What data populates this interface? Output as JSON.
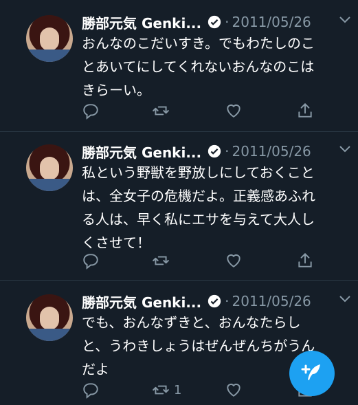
{
  "tweets": [
    {
      "name": "勝部元気 Genki...",
      "date": "2011/05/26",
      "lines": [
        "おんなのこだいすき。でもわたしのこ",
        "とあいてにしてくれないおんなのこは",
        "きらーい。"
      ],
      "retweet_count": ""
    },
    {
      "name": "勝部元気 Genki...",
      "date": "2011/05/26",
      "lines": [
        "私という野獣を野放しにしておくこと",
        "は、全女子の危機だよ。正義感あふれ",
        "る人は、早く私にエサを与えて大人し",
        "くさせて！"
      ],
      "retweet_count": ""
    },
    {
      "name": "勝部元気 Genki...",
      "date": "2011/05/26",
      "lines": [
        "でも、おんなずきと、おんなたらし",
        "と、うわきしょうはぜんぜんちがうん",
        "だよ"
      ],
      "retweet_count": "1"
    }
  ],
  "icons": {
    "reply": "reply-icon",
    "retweet": "retweet-icon",
    "like": "heart-icon",
    "share": "share-icon",
    "verified": "verified-badge-icon",
    "more": "chevron-down-icon",
    "compose": "compose-tweet-icon"
  },
  "colors": {
    "background": "#151e28",
    "accent": "#1da1f2",
    "muted": "#8899a6"
  }
}
